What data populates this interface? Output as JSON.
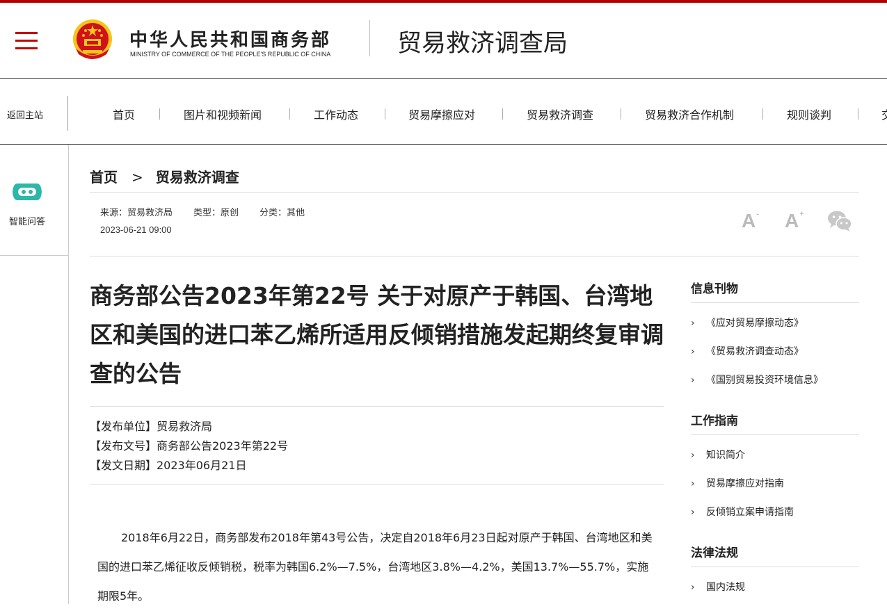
{
  "header": {
    "brand_cn": "中华人民共和国商务部",
    "brand_en": "MINISTRY OF COMMERCE OF THE PEOPLE'S REPUBLIC OF CHINA",
    "bureau": "贸易救济调查局"
  },
  "nav": {
    "back": "返回主站",
    "items": [
      "首页",
      "图片和视频新闻",
      "工作动态",
      "贸易摩擦应对",
      "贸易救济调查",
      "贸易救济合作机制",
      "规则谈判",
      "交"
    ]
  },
  "rail": {
    "qa_label": "智能问答"
  },
  "breadcrumb": {
    "home": "首页",
    "sep": ">",
    "current": "贸易救济调查"
  },
  "meta": {
    "source": "来源：贸易救济局",
    "type": "类型：原创",
    "category": "分类：其他",
    "date": "2023-06-21 09:00",
    "font_smaller": "A",
    "font_larger": "A",
    "minus": "-",
    "plus": "+"
  },
  "article": {
    "title": "商务部公告2023年第22号 关于对原产于韩国、台湾地区和美国的进口苯乙烯所适用反倾销措施发起期终复审调查的公告",
    "publisher": "【发布单位】贸易救济局",
    "doc_no": "【发布文号】商务部公告2023年第22号",
    "pub_date": "【发文日期】2023年06月21日",
    "para1": "2018年6月22日，商务部发布2018年第43号公告，决定自2018年6月23日起对原产于韩国、台湾地区和美国的进口苯乙烯征收反倾销税，税率为韩国6.2%—7.5%，台湾地区3.8%—4.2%，美国13.7%—55.7%，实施期限5年。"
  },
  "sidebar": {
    "sections": [
      {
        "title": "信息刊物",
        "items": [
          "《应对贸易摩擦动态》",
          "《贸易救济调查动态》",
          "《国别贸易投资环境信息》"
        ]
      },
      {
        "title": "工作指南",
        "items": [
          "知识简介",
          "贸易摩擦应对指南",
          "反倾销立案申请指南"
        ]
      },
      {
        "title": "法律法规",
        "items": [
          "国内法规"
        ]
      }
    ],
    "chevron": "›"
  },
  "colors": {
    "accent": "#b50000",
    "emblem_red": "#d1121b",
    "emblem_gold": "#f5c518",
    "qa_teal": "#2bb8a8"
  }
}
